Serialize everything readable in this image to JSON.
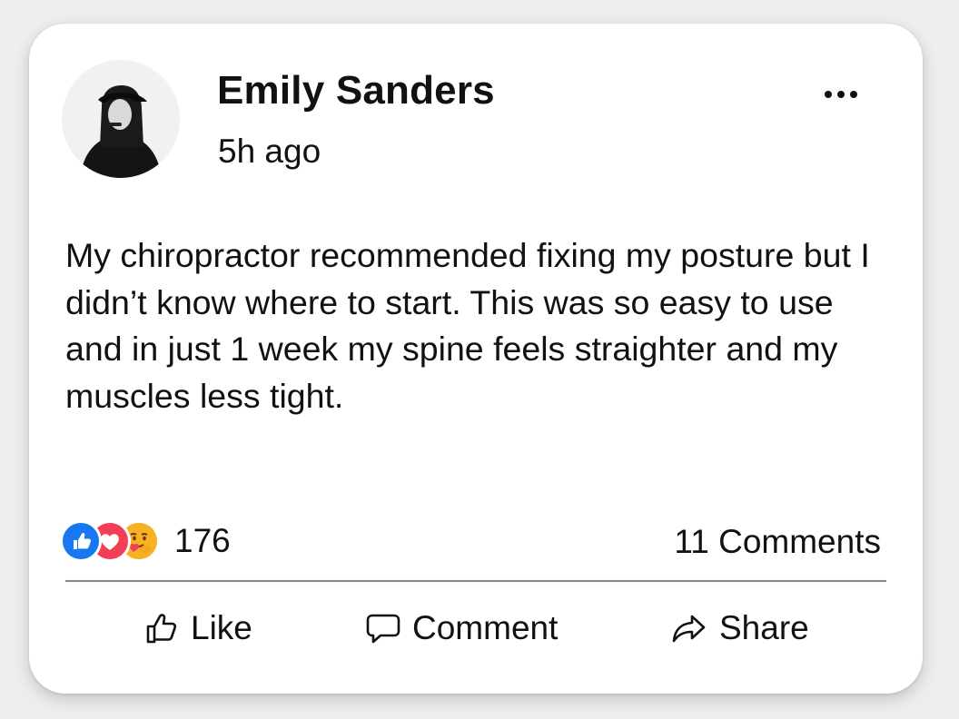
{
  "post": {
    "author": "Emily Sanders",
    "timestamp": "5h ago",
    "body": "My chiropractor recommended fixing my posture but I didn’t know where to start. This was so easy to use and in just 1 week my spine feels straighter and my muscles less tight.",
    "more_icon": "more-horizontal-icon"
  },
  "reactions": {
    "types": [
      "like-reaction-icon",
      "love-reaction-icon",
      "care-reaction-icon"
    ],
    "count": "176"
  },
  "comments": {
    "count_label": "11 Comments"
  },
  "actions": [
    {
      "label": "Like",
      "icon": "thumbs-up-icon"
    },
    {
      "label": "Comment",
      "icon": "comment-bubble-icon"
    },
    {
      "label": "Share",
      "icon": "share-arrow-icon"
    }
  ],
  "colors": {
    "like": "#1877f2",
    "love": "#f33e58",
    "care": "#f7b125",
    "text": "#111111",
    "divider": "#8a8a8a"
  }
}
